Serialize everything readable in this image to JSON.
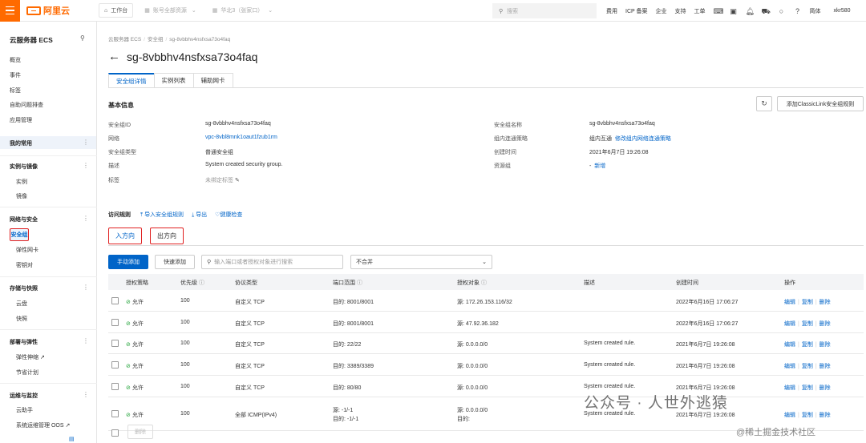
{
  "topbar": {
    "logo": "阿里云",
    "workbench": "工作台",
    "account": "账号全部资源",
    "region": "华北3（张家口）",
    "search_placeholder": "搜索",
    "links": [
      "费用",
      "ICP 备案",
      "企业",
      "支持",
      "工单"
    ],
    "lang": "简体",
    "user": "xkr580"
  },
  "sidebar": {
    "title": "云服务器 ECS",
    "top_items": [
      "概览",
      "事件",
      "标签",
      "自助问题排查",
      "应用管理"
    ],
    "favorites": "我的常用",
    "groups": [
      {
        "name": "实例与镜像",
        "items": [
          "实例",
          "镜像"
        ]
      },
      {
        "name": "网络与安全",
        "items": [
          "安全组",
          "弹性网卡",
          "密钥对"
        ]
      },
      {
        "name": "存储与快照",
        "items": [
          "云盘",
          "快照"
        ]
      },
      {
        "name": "部署与弹性",
        "items": [
          "弹性伸缩",
          "节省计划"
        ]
      },
      {
        "name": "运维与监控",
        "items": [
          "云助手",
          "系统运维管理 OOS"
        ]
      }
    ]
  },
  "breadcrumb": [
    "云服务器 ECS",
    "安全组",
    "sg-8vbbhv4nsfxsa73o4faq"
  ],
  "page_title": "sg-8vbbhv4nsfxsa73o4faq",
  "tabs": [
    "安全组详情",
    "实例列表",
    "辅助网卡"
  ],
  "basic": {
    "title": "基本信息",
    "add_classic": "添加ClassicLink安全组规则",
    "left": [
      {
        "label": "安全组ID",
        "value": "sg-8vbbhv4nsfxsa73o4faq"
      },
      {
        "label": "网络",
        "value": "vpc-8vbl8mnk1oaut1fzub1rm"
      },
      {
        "label": "安全组类型",
        "value": "普通安全组"
      },
      {
        "label": "描述",
        "value": "System created security group."
      },
      {
        "label": "标签",
        "value": "未绑定标签"
      }
    ],
    "right": [
      {
        "label": "安全组名称",
        "value": "sg-8vbbhv4nsfxsa73o4faq"
      },
      {
        "label": "组内连通策略",
        "value": "组内互通",
        "link": "修改组内网络连通策略"
      },
      {
        "label": "创建时间",
        "value": "2021年6月7日 19:26:08"
      },
      {
        "label": "资源组",
        "value": "-",
        "link": "新增"
      }
    ]
  },
  "rules": {
    "title": "访问规则",
    "actions": [
      "导入安全组规则",
      "导出",
      "健康检查"
    ],
    "directions": [
      "入方向",
      "出方向"
    ],
    "btn_add": "手动添加",
    "btn_quick": "快速添加",
    "search_placeholder": "输入端口或者授权对象进行搜索",
    "merge_select": "不合并",
    "columns": [
      "授权策略",
      "优先级",
      "协议类型",
      "端口范围",
      "授权对象",
      "描述",
      "创建时间",
      "操作"
    ],
    "ops": [
      "编辑",
      "复制",
      "删除"
    ],
    "rows": [
      {
        "policy": "允许",
        "priority": "100",
        "proto": "自定义 TCP",
        "port": "目的: 8001/8001",
        "auth": "源: 172.26.153.116/32",
        "desc": "",
        "time": "2022年6月16日 17:06:27"
      },
      {
        "policy": "允许",
        "priority": "100",
        "proto": "自定义 TCP",
        "port": "目的: 8001/8001",
        "auth": "源: 47.92.36.182",
        "desc": "",
        "time": "2022年6月16日 17:06:27"
      },
      {
        "policy": "允许",
        "priority": "100",
        "proto": "自定义 TCP",
        "port": "目的: 22/22",
        "auth": "源: 0.0.0.0/0",
        "desc": "System created rule.",
        "time": "2021年6月7日 19:26:08"
      },
      {
        "policy": "允许",
        "priority": "100",
        "proto": "自定义 TCP",
        "port": "目的: 3389/3389",
        "auth": "源: 0.0.0.0/0",
        "desc": "System created rule.",
        "time": "2021年6月7日 19:26:08"
      },
      {
        "policy": "允许",
        "priority": "100",
        "proto": "自定义 TCP",
        "port": "目的: 80/80",
        "auth": "源: 0.0.0.0/0",
        "desc": "System created rule.",
        "time": "2021年6月7日 19:26:08"
      },
      {
        "policy": "允许",
        "priority": "100",
        "proto": "全部 ICMP(IPv4)",
        "port": "源: -1/-1",
        "port2": "目的: -1/-1",
        "auth": "源: 0.0.0.0/0",
        "auth2": "目的:",
        "desc": "System created rule.",
        "time": "2021年6月7日 19:26:08"
      }
    ],
    "delete_btn": "删除"
  },
  "watermark": {
    "main": "公众号 · 人世外逃猿",
    "sub": "@稀土掘金技术社区"
  }
}
